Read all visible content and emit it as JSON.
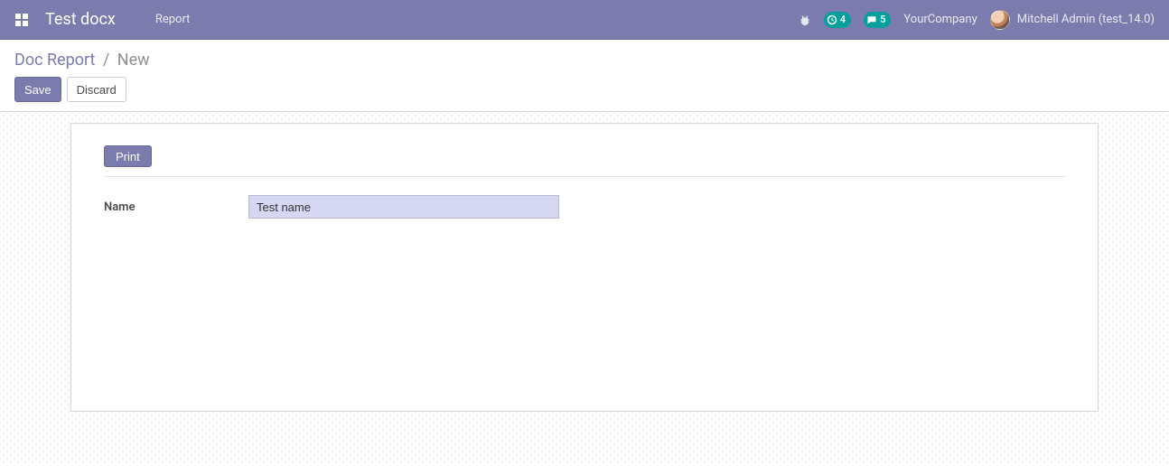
{
  "navbar": {
    "brand": "Test docx",
    "menu": {
      "report": "Report"
    },
    "badges": {
      "activities": "4",
      "messages": "5"
    },
    "company": "YourCompany",
    "username": "Mitchell Admin (test_14.0)"
  },
  "breadcrumb": {
    "parent": "Doc Report",
    "sep": "/",
    "current": "New"
  },
  "buttons": {
    "save": "Save",
    "discard": "Discard",
    "print": "Print"
  },
  "form": {
    "name_label": "Name",
    "name_value": "Test name"
  }
}
